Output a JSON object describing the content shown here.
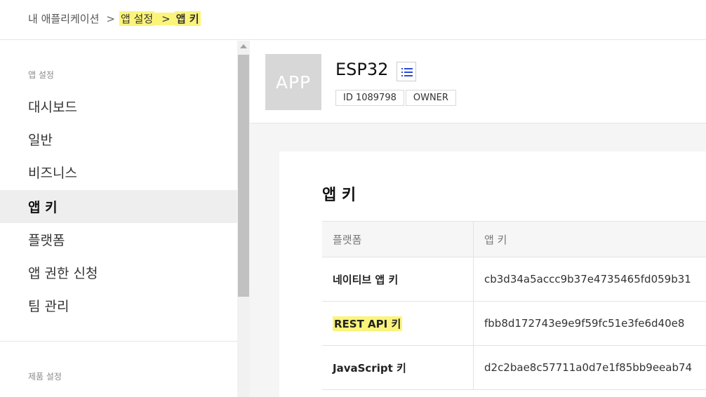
{
  "breadcrumb": {
    "root": "내 애플리케이션",
    "sep": ">",
    "level1": "앱 설정",
    "level2": "앱 키"
  },
  "sidebar": {
    "section_app": "앱 설정",
    "items": [
      {
        "label": "대시보드"
      },
      {
        "label": "일반"
      },
      {
        "label": "비즈니스"
      },
      {
        "label": "앱 키",
        "active": true
      },
      {
        "label": "플랫폼"
      },
      {
        "label": "앱 권한 신청"
      },
      {
        "label": "팀 관리"
      }
    ],
    "section_product": "제품 설정"
  },
  "app": {
    "thumb_label": "APP",
    "name": "ESP32",
    "id_tag": "ID 1089798",
    "role_tag": "OWNER",
    "list_icon": "list-icon"
  },
  "keys": {
    "title": "앱 키",
    "columns": [
      "플랫폼",
      "앱 키"
    ],
    "rows": [
      {
        "platform": "네이티브 앱 키",
        "key": "cb3d34a5accc9b37e4735465fd059b31"
      },
      {
        "platform": "REST API 키",
        "key": "fbb8d172743e9e9f59fc51e3fe6d40e8",
        "highlight": true
      },
      {
        "platform": "JavaScript 키",
        "key": "d2c2bae8c57711a0d7e1f85bb9eeab74"
      }
    ]
  },
  "colors": {
    "highlight": "#fbf47a",
    "active_bg": "#eeeeee",
    "main_bg": "#f5f5f5",
    "thumb_bg": "#d7d7d7"
  }
}
